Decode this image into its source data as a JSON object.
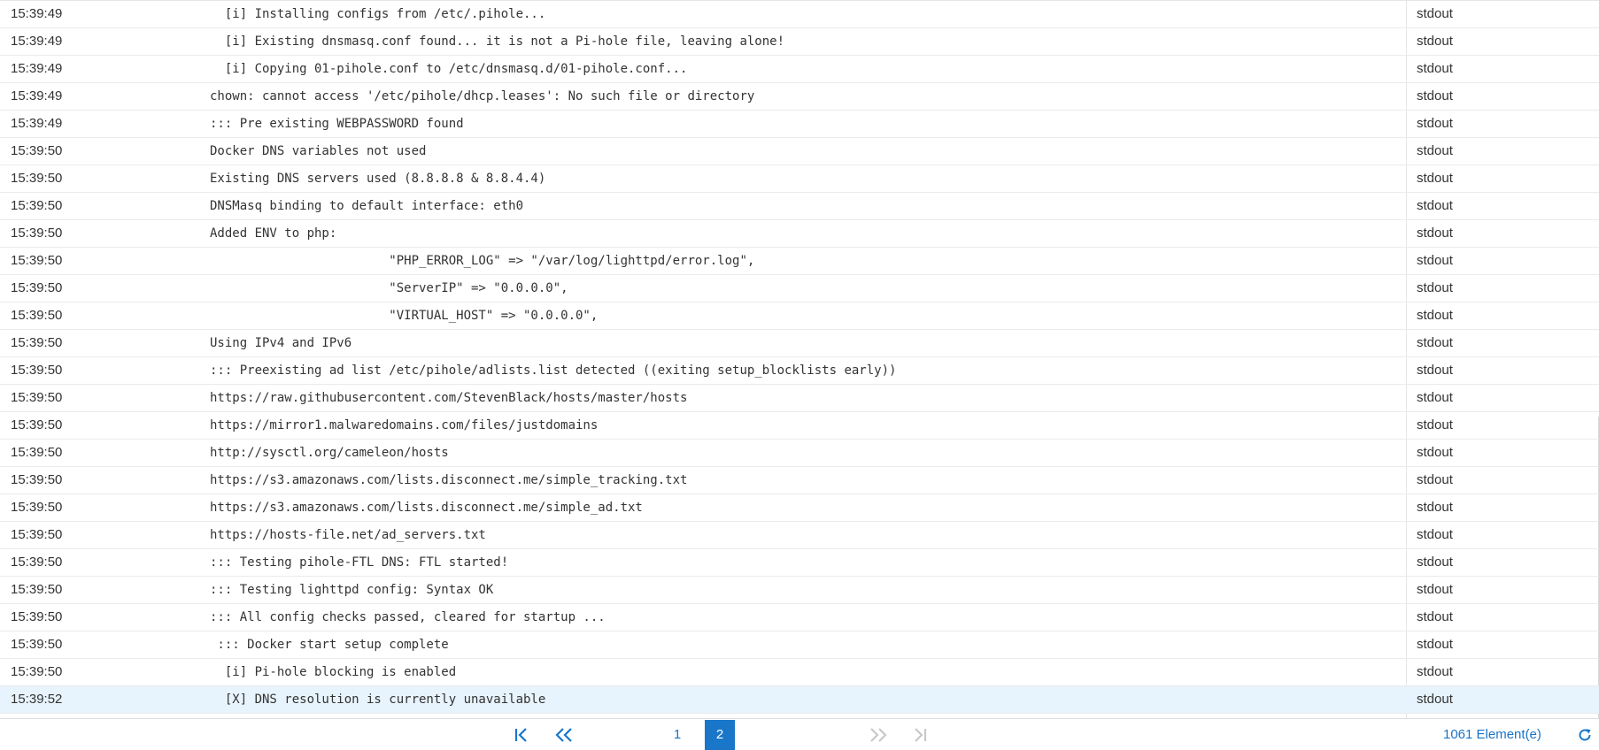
{
  "log": {
    "rows": [
      {
        "time": "15:39:49",
        "message": "  [i] Installing configs from /etc/.pihole...",
        "type": "stdout"
      },
      {
        "time": "15:39:49",
        "message": "  [i] Existing dnsmasq.conf found... it is not a Pi-hole file, leaving alone!",
        "type": "stdout"
      },
      {
        "time": "15:39:49",
        "message": "  [i] Copying 01-pihole.conf to /etc/dnsmasq.d/01-pihole.conf...",
        "type": "stdout"
      },
      {
        "time": "15:39:49",
        "message": "chown: cannot access '/etc/pihole/dhcp.leases': No such file or directory",
        "type": "stdout"
      },
      {
        "time": "15:39:49",
        "message": "::: Pre existing WEBPASSWORD found",
        "type": "stdout"
      },
      {
        "time": "15:39:50",
        "message": "Docker DNS variables not used",
        "type": "stdout"
      },
      {
        "time": "15:39:50",
        "message": "Existing DNS servers used (8.8.8.8 & 8.8.4.4)",
        "type": "stdout"
      },
      {
        "time": "15:39:50",
        "message": "DNSMasq binding to default interface: eth0",
        "type": "stdout"
      },
      {
        "time": "15:39:50",
        "message": "Added ENV to php:",
        "type": "stdout"
      },
      {
        "time": "15:39:50",
        "message": "                        \"PHP_ERROR_LOG\" => \"/var/log/lighttpd/error.log\",",
        "type": "stdout"
      },
      {
        "time": "15:39:50",
        "message": "                        \"ServerIP\" => \"0.0.0.0\",",
        "type": "stdout"
      },
      {
        "time": "15:39:50",
        "message": "                        \"VIRTUAL_HOST\" => \"0.0.0.0\",",
        "type": "stdout"
      },
      {
        "time": "15:39:50",
        "message": "Using IPv4 and IPv6",
        "type": "stdout"
      },
      {
        "time": "15:39:50",
        "message": "::: Preexisting ad list /etc/pihole/adlists.list detected ((exiting setup_blocklists early))",
        "type": "stdout"
      },
      {
        "time": "15:39:50",
        "message": "https://raw.githubusercontent.com/StevenBlack/hosts/master/hosts",
        "type": "stdout"
      },
      {
        "time": "15:39:50",
        "message": "https://mirror1.malwaredomains.com/files/justdomains",
        "type": "stdout"
      },
      {
        "time": "15:39:50",
        "message": "http://sysctl.org/cameleon/hosts",
        "type": "stdout"
      },
      {
        "time": "15:39:50",
        "message": "https://s3.amazonaws.com/lists.disconnect.me/simple_tracking.txt",
        "type": "stdout"
      },
      {
        "time": "15:39:50",
        "message": "https://s3.amazonaws.com/lists.disconnect.me/simple_ad.txt",
        "type": "stdout"
      },
      {
        "time": "15:39:50",
        "message": "https://hosts-file.net/ad_servers.txt",
        "type": "stdout"
      },
      {
        "time": "15:39:50",
        "message": "::: Testing pihole-FTL DNS: FTL started!",
        "type": "stdout"
      },
      {
        "time": "15:39:50",
        "message": "::: Testing lighttpd config: Syntax OK",
        "type": "stdout"
      },
      {
        "time": "15:39:50",
        "message": "::: All config checks passed, cleared for startup ...",
        "type": "stdout"
      },
      {
        "time": "15:39:50",
        "message": " ::: Docker start setup complete",
        "type": "stdout"
      },
      {
        "time": "15:39:50",
        "message": "  [i] Pi-hole blocking is enabled",
        "type": "stdout"
      },
      {
        "time": "15:39:52",
        "message": "  [X] DNS resolution is currently unavailable",
        "type": "stdout",
        "selected": true
      }
    ]
  },
  "pager": {
    "pages": [
      "1",
      "2"
    ],
    "current_page": 2,
    "count_label": "1061 Element(e)"
  },
  "colors": {
    "accent": "#1976c9",
    "selected_row": "#e8f4fd",
    "text": "#333333",
    "disabled": "#c8c8c8"
  },
  "icons": {
    "first": "first-page-icon",
    "prev": "previous-page-icon",
    "next": "next-page-icon",
    "last": "last-page-icon",
    "refresh": "refresh-icon"
  }
}
